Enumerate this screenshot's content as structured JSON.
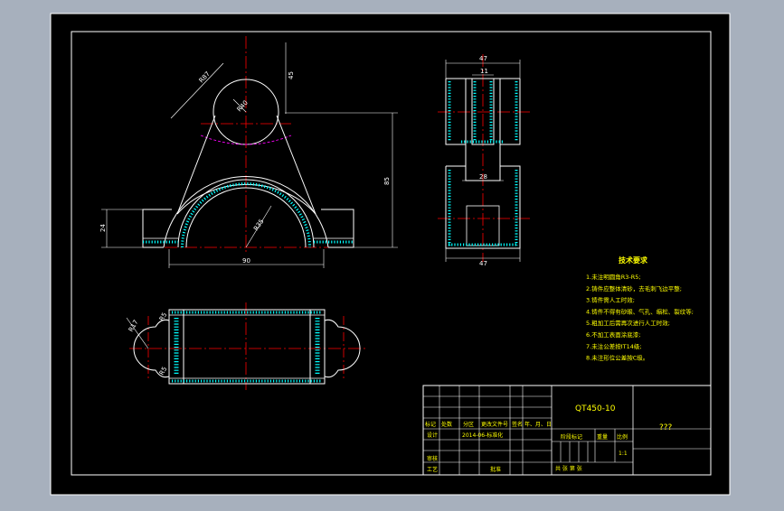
{
  "drawing": {
    "background": "#000000",
    "viewport_bg": "#a7b0bd",
    "line_color": "#ffffff",
    "center_line_color": "#ff0000",
    "hatch_color": "#00ffff",
    "phantom_color": "#ff00ff",
    "frame_color": "#ffffff",
    "text_color": "#ffff00"
  },
  "front_view": {
    "dims": {
      "r87": "R87",
      "r40": "R40",
      "r35": "R35",
      "d45": "45",
      "d85": "85",
      "d24": "24",
      "d90": "90"
    }
  },
  "side_view": {
    "dims": {
      "w47_top": "47",
      "w11": "11",
      "w28": "28",
      "w47_bot": "47"
    }
  },
  "top_view": {
    "dims": {
      "r17": "R17",
      "r5a": "R5",
      "r5b": "R5"
    }
  },
  "tech_req": {
    "title": "技术要求",
    "items": [
      "1.未注明圆角R3-R5;",
      "2.铸件应整体清砂，去毛刺飞边平整;",
      "3.铸件需人工时效;",
      "4.铸件不得有砂眼、气孔、缩松、裂纹等;",
      "5.粗加工后需再次进行人工时效;",
      "6.不加工表面涂底漆;",
      "7.未注公差按IT14级;",
      "8.未注形位公差按C级。"
    ]
  },
  "title_block": {
    "material": "QT450-10",
    "part_name": "???",
    "h_mark": "标记",
    "h_count": "处数",
    "h_zone": "分区",
    "h_doc": "更改文件号",
    "h_sign": "签名",
    "h_date": "年、月、日",
    "design": "设计",
    "date_std": "2014-06-标准化",
    "review": "审核",
    "process": "工艺",
    "approve": "批准",
    "stage_mark": "阶段标记",
    "weight": "重量",
    "scale": "比例",
    "scale_val": "1:1",
    "sheets": "共    张  第    张"
  }
}
